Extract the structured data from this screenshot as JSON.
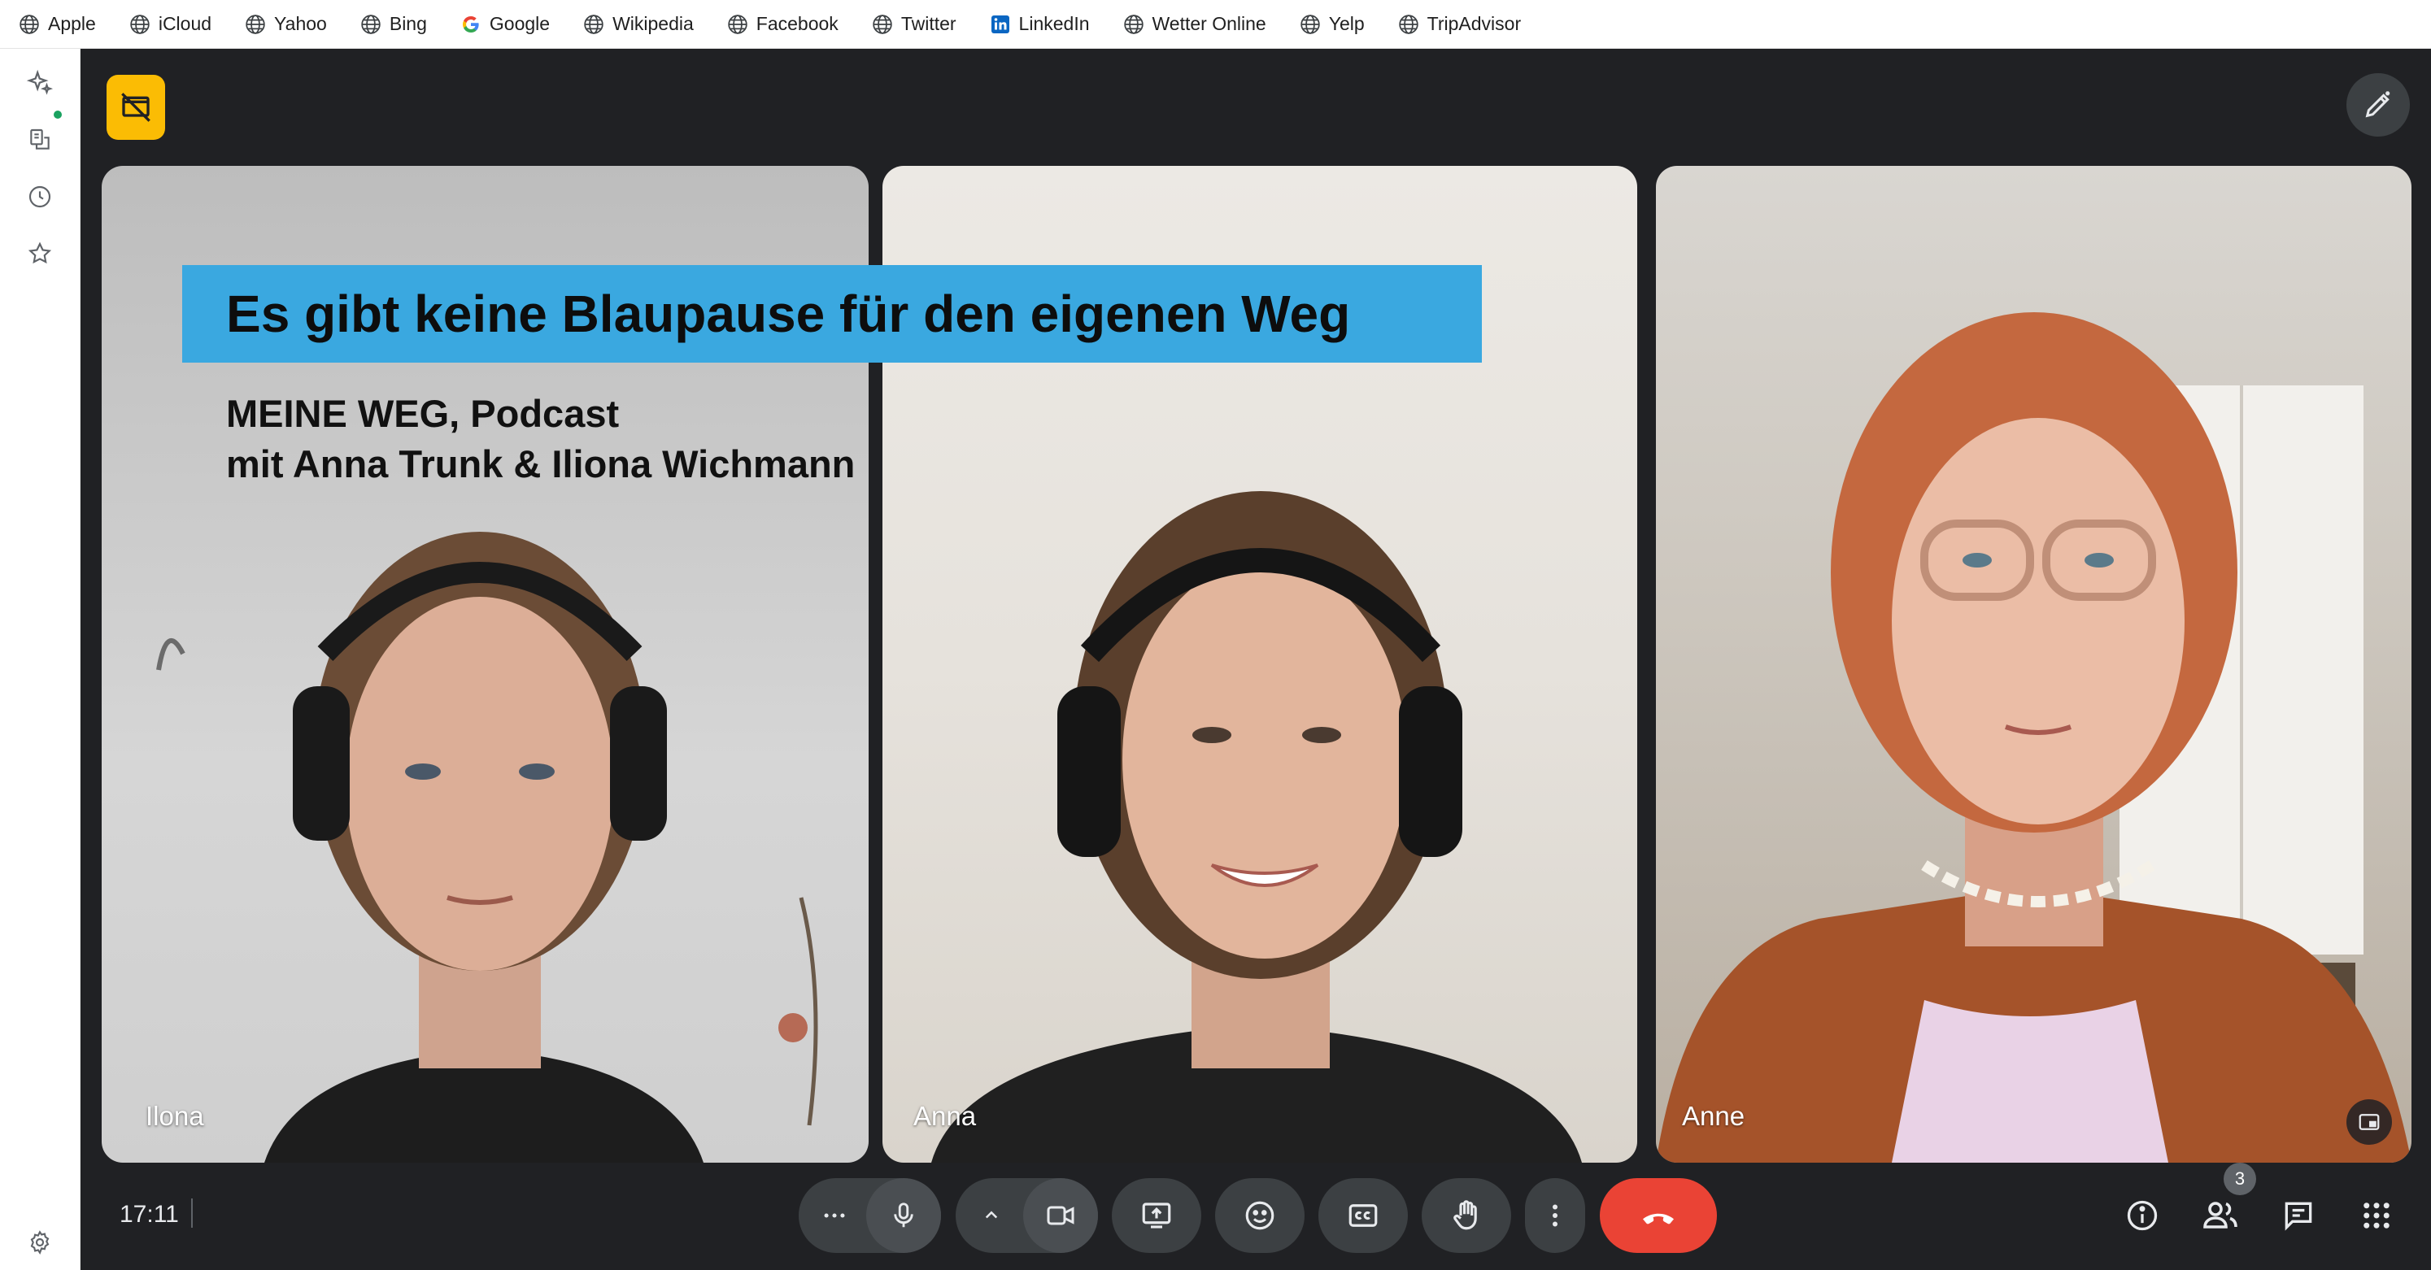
{
  "bookmarks": [
    {
      "label": "Apple",
      "icon": "globe-icon"
    },
    {
      "label": "iCloud",
      "icon": "globe-icon"
    },
    {
      "label": "Yahoo",
      "icon": "globe-icon"
    },
    {
      "label": "Bing",
      "icon": "globe-icon"
    },
    {
      "label": "Google",
      "icon": "google-icon"
    },
    {
      "label": "Wikipedia",
      "icon": "globe-icon"
    },
    {
      "label": "Facebook",
      "icon": "globe-icon"
    },
    {
      "label": "Twitter",
      "icon": "globe-icon"
    },
    {
      "label": "LinkedIn",
      "icon": "linkedin-icon"
    },
    {
      "label": "Wetter Online",
      "icon": "globe-icon"
    },
    {
      "label": "Yelp",
      "icon": "globe-icon"
    },
    {
      "label": "TripAdvisor",
      "icon": "globe-icon"
    }
  ],
  "sidebar": {
    "items": [
      "sparkle-icon",
      "reading-list-icon",
      "history-icon",
      "bookmark-star-icon"
    ],
    "bottom": "settings-icon"
  },
  "overlay": {
    "banner_title": "Es gibt keine Blaupause für den eigenen Weg",
    "subtitle_line1": "MEINE WEG, Podcast",
    "subtitle_line2": "mit Anna Trunk & Iliona Wichmann"
  },
  "participants": [
    {
      "name": "Ilona"
    },
    {
      "name": "Anna"
    },
    {
      "name": "Anne"
    }
  ],
  "controls": {
    "time": "17:11",
    "people_count": "3"
  },
  "colors": {
    "meet_bg": "#202124",
    "control_bg": "#3c4043",
    "end_call": "#ea4335",
    "banner": "#3aa8e0",
    "badge": "#fbbc04"
  }
}
